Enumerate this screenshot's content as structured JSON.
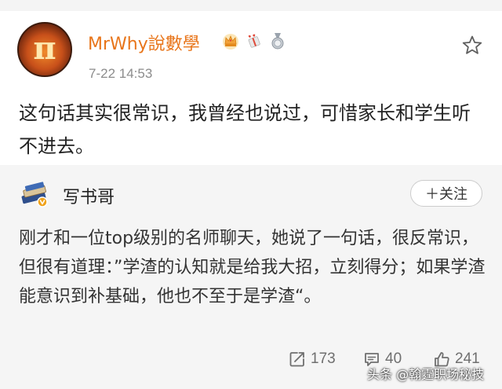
{
  "post": {
    "author": "MrWhy說數學",
    "avatar_glyph": "π",
    "badges": [
      "crown-badge-icon",
      "gift-badge-icon",
      "medal-badge-icon"
    ],
    "timestamp": "7-22 14:53",
    "text": "这句话其实很常识，我曾经也说过，可惜家长和学生听不进去。"
  },
  "repost": {
    "author": "写书哥",
    "follow_label": "＋关注",
    "text": "刚才和一位top级别的名师聊天，她说了一句话，很反常识，但很有道理：”学渣的认知就是给我大招，立刻得分；如果学渣能意识到补基础，他也不至于是学渣“。"
  },
  "actions": {
    "repost_count": "173",
    "comment_count": "40",
    "like_count": "241"
  },
  "watermark": "头条 @翰霆职场秘技",
  "colors": {
    "author_accent": "#e8751a",
    "repost_background": "#f5f5f5",
    "secondary_text": "#8c8c8c"
  }
}
